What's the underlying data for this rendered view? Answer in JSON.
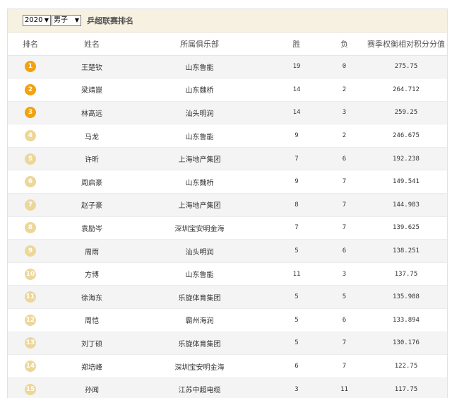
{
  "filters": {
    "year": "2020",
    "gender": "男子",
    "title": "乒超联赛排名"
  },
  "colors": {
    "top_badge": "#f2a20f",
    "other_badge": "#ecd79a",
    "header_bg": "#f6f1e0"
  },
  "table": {
    "headers": {
      "rank": "排名",
      "name": "姓名",
      "club": "所属俱乐部",
      "wins": "胜",
      "losses": "负",
      "score": "赛季权衡相对积分分值"
    },
    "rows": [
      {
        "rank": "1",
        "name": "王楚钦",
        "club": "山东鲁能",
        "wins": "19",
        "losses": "0",
        "score": "275.75",
        "top": true
      },
      {
        "rank": "2",
        "name": "梁靖崑",
        "club": "山东魏桥",
        "wins": "14",
        "losses": "2",
        "score": "264.712",
        "top": true
      },
      {
        "rank": "3",
        "name": "林高远",
        "club": "汕头明润",
        "wins": "14",
        "losses": "3",
        "score": "259.25",
        "top": true
      },
      {
        "rank": "4",
        "name": "马龙",
        "club": "山东鲁能",
        "wins": "9",
        "losses": "2",
        "score": "246.675",
        "top": false
      },
      {
        "rank": "5",
        "name": "许昕",
        "club": "上海地产集团",
        "wins": "7",
        "losses": "6",
        "score": "192.238",
        "top": false
      },
      {
        "rank": "6",
        "name": "周启豪",
        "club": "山东魏桥",
        "wins": "9",
        "losses": "7",
        "score": "149.541",
        "top": false
      },
      {
        "rank": "7",
        "name": "赵子豪",
        "club": "上海地产集团",
        "wins": "8",
        "losses": "7",
        "score": "144.983",
        "top": false
      },
      {
        "rank": "8",
        "name": "袁励岑",
        "club": "深圳宝安明金海",
        "wins": "7",
        "losses": "7",
        "score": "139.625",
        "top": false
      },
      {
        "rank": "9",
        "name": "周雨",
        "club": "汕头明润",
        "wins": "5",
        "losses": "6",
        "score": "138.251",
        "top": false
      },
      {
        "rank": "10",
        "name": "方博",
        "club": "山东鲁能",
        "wins": "11",
        "losses": "3",
        "score": "137.75",
        "top": false
      },
      {
        "rank": "11",
        "name": "徐海东",
        "club": "乐旋体育集团",
        "wins": "5",
        "losses": "5",
        "score": "135.988",
        "top": false
      },
      {
        "rank": "12",
        "name": "周恺",
        "club": "霸州海润",
        "wins": "5",
        "losses": "6",
        "score": "133.894",
        "top": false
      },
      {
        "rank": "13",
        "name": "刘丁硕",
        "club": "乐旋体育集团",
        "wins": "5",
        "losses": "7",
        "score": "130.176",
        "top": false
      },
      {
        "rank": "14",
        "name": "郑培峰",
        "club": "深圳宝安明金海",
        "wins": "6",
        "losses": "7",
        "score": "122.75",
        "top": false
      },
      {
        "rank": "15",
        "name": "孙闻",
        "club": "江苏中超电缆",
        "wins": "3",
        "losses": "11",
        "score": "117.75",
        "top": false
      }
    ]
  }
}
